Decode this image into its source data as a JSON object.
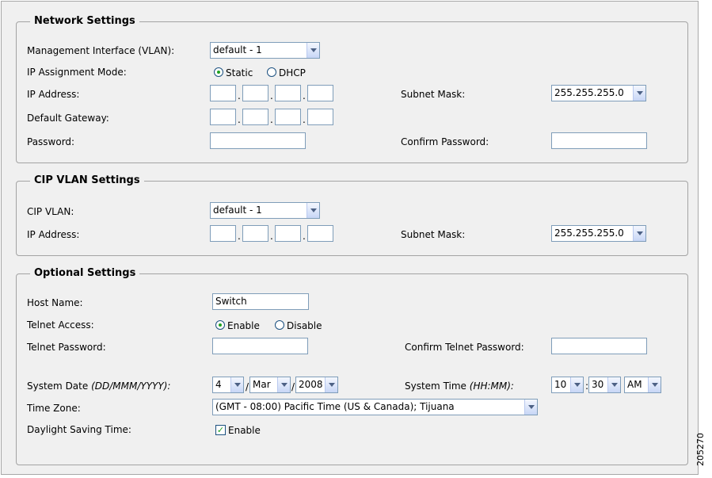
{
  "network": {
    "legend": "Network Settings",
    "mgmt_label": "Management Interface (VLAN):",
    "mgmt_value": "default - 1",
    "ip_mode_label": "IP Assignment Mode:",
    "static_label": "Static",
    "dhcp_label": "DHCP",
    "ip_label": "IP Address:",
    "subnet_label": "Subnet Mask:",
    "subnet_value": "255.255.255.0",
    "gateway_label": "Default Gateway:",
    "password_label": "Password:",
    "confirm_label": "Confirm Password:",
    "dot": "."
  },
  "cip": {
    "legend": "CIP VLAN Settings",
    "vlan_label": "CIP VLAN:",
    "vlan_value": "default - 1",
    "ip_label": "IP Address:",
    "subnet_label": "Subnet Mask:",
    "subnet_value": "255.255.255.0"
  },
  "optional": {
    "legend": "Optional Settings",
    "host_label": "Host Name:",
    "host_value": "Switch",
    "telnet_label": "Telnet Access:",
    "enable_label": "Enable",
    "disable_label": "Disable",
    "telnet_pw_label": "Telnet Password:",
    "confirm_telnet_label": "Confirm Telnet Password:",
    "date_label": "System Date",
    "date_format": "(DD/MMM/YYYY):",
    "day": "4",
    "month": "Mar",
    "year": "2008",
    "slash": "/",
    "time_label": "System Time",
    "time_format": "(HH:MM):",
    "hour": "10",
    "minute": "30",
    "ampm": "AM",
    "colon": ":",
    "tz_label": "Time Zone:",
    "tz_value": "(GMT - 08:00) Pacific Time (US & Canada); Tijuana",
    "dst_label": "Daylight Saving Time:",
    "dst_enable": "Enable"
  },
  "state": {
    "ip_mode": "Static",
    "telnet_access": "Enable",
    "dst_checked": true
  },
  "figure_id": "205270"
}
